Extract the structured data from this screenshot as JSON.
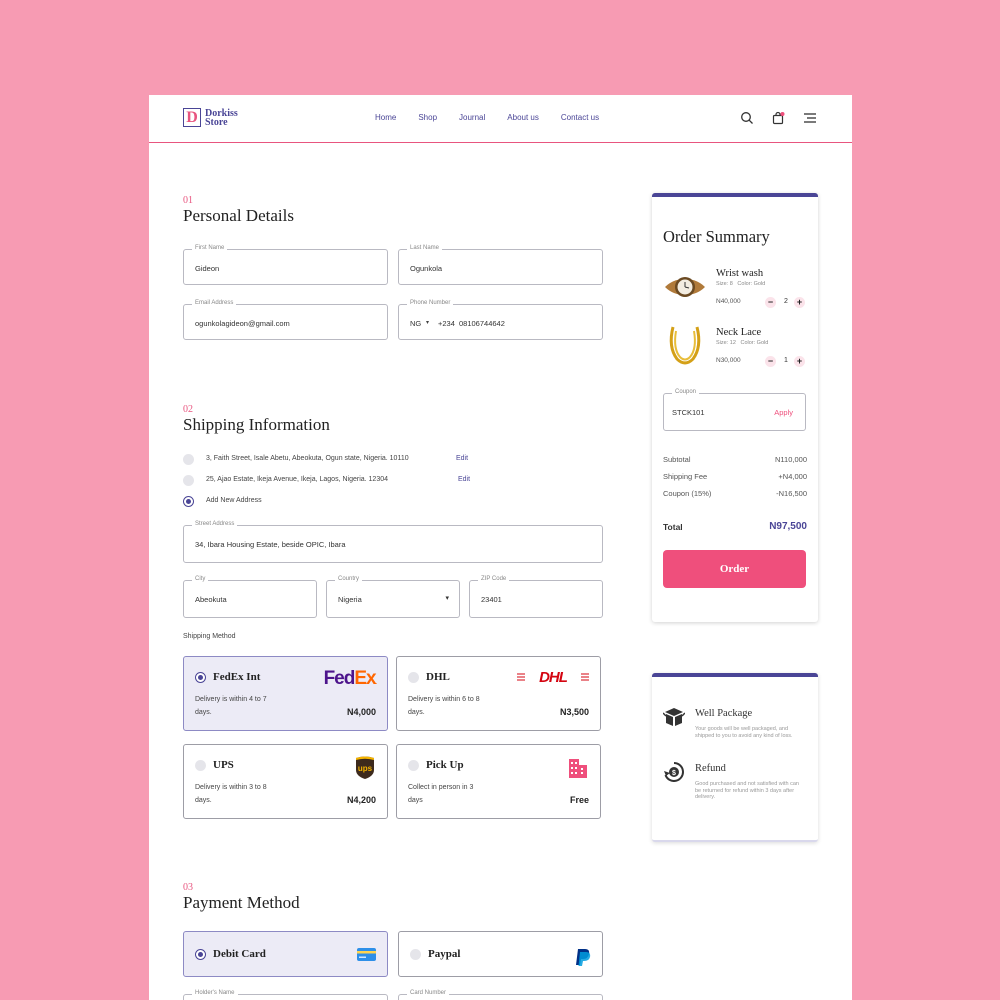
{
  "brand": {
    "logo_letter": "D",
    "line1": "Dorkiss",
    "line2": "Store"
  },
  "nav": {
    "items": [
      "Home",
      "Shop",
      "Journal",
      "About us",
      "Contact us"
    ]
  },
  "icons": {
    "search": "search-icon",
    "bag": "shopping-bag-icon",
    "menu": "hamburger-menu-icon"
  },
  "personal": {
    "num": "01",
    "title": "Personal Details",
    "first_name": {
      "label": "First Name",
      "value": "Gideon"
    },
    "last_name": {
      "label": "Last Name",
      "value": "Ogunkola"
    },
    "email": {
      "label": "Email Address",
      "value": "ogunkolagideon@gmail.com"
    },
    "phone": {
      "label": "Phone Number",
      "country": "NG",
      "code": "+234",
      "value": "08106744642"
    }
  },
  "shipping": {
    "num": "02",
    "title": "Shipping Information",
    "addresses": [
      {
        "text": "3, Faith Street, Isale Abetu, Abeokuta, Ogun state, Nigeria. 10110",
        "edit": "Edit"
      },
      {
        "text": "25, Ajao Estate, Ikeja Avenue, Ikeja, Lagos, Nigeria. 12304",
        "edit": "Edit"
      }
    ],
    "add_new": "Add New Address",
    "street": {
      "label": "Street Address",
      "value": "34, Ibara Housing Estate, beside OPIC, Ibara"
    },
    "city": {
      "label": "City",
      "value": "Abeokuta"
    },
    "country": {
      "label": "Country",
      "value": "Nigeria"
    },
    "zip": {
      "label": "ZIP Code",
      "value": "23401"
    },
    "method_label": "Shipping Method",
    "methods": [
      {
        "name": "FedEx Int",
        "desc": "Delivery is within 4 to 7 days.",
        "price": "N4,000",
        "logo": "FedEx",
        "selected": true
      },
      {
        "name": "DHL",
        "desc": "Delivery is within 6 to 8 days.",
        "price": "N3,500",
        "logo": "DHL",
        "selected": false
      },
      {
        "name": "UPS",
        "desc": "Delivery is within 3 to 8 days.",
        "price": "N4,200",
        "logo": "ups",
        "selected": false
      },
      {
        "name": "Pick Up",
        "desc": "Collect in person in 3 days",
        "price": "Free",
        "logo": "building-icon",
        "selected": false
      }
    ]
  },
  "payment": {
    "num": "03",
    "title": "Payment Method",
    "options": [
      {
        "name": "Debit Card",
        "icon": "credit-card-icon",
        "selected": true
      },
      {
        "name": "Paypal",
        "icon": "paypal-icon",
        "selected": false
      }
    ],
    "holder_label": "Holder's Name",
    "card_label": "Card Number"
  },
  "summary": {
    "title": "Order Summary",
    "items": [
      {
        "name": "Wrist wash",
        "size": "Size: 8",
        "color": "Color: Gold",
        "price": "N40,000",
        "qty": "2"
      },
      {
        "name": "Neck Lace",
        "size": "Size: 12",
        "color": "Color: Gold",
        "price": "N30,000",
        "qty": "1"
      }
    ],
    "coupon": {
      "label": "Coupon",
      "value": "STCK101",
      "apply": "Apply"
    },
    "rows": [
      {
        "label": "Subtotal",
        "value": "N110,000"
      },
      {
        "label": "Shipping Fee",
        "value": "+N4,000"
      },
      {
        "label": "Coupon (15%)",
        "value": "-N16,500"
      }
    ],
    "total_label": "Total",
    "total_value": "N97,500",
    "order_button": "Order"
  },
  "features": [
    {
      "title": "Well Package",
      "desc": "Your goods will be well packaged, and shipped to you to avoid any kind of loss."
    },
    {
      "title": "Refund",
      "desc": "Good purchased and not satisfied with can be returned for refund within 3 days after delivery."
    }
  ],
  "colors": {
    "accent": "#4a4596",
    "pink": "#ef4f7c",
    "background": "#f79bb3"
  }
}
